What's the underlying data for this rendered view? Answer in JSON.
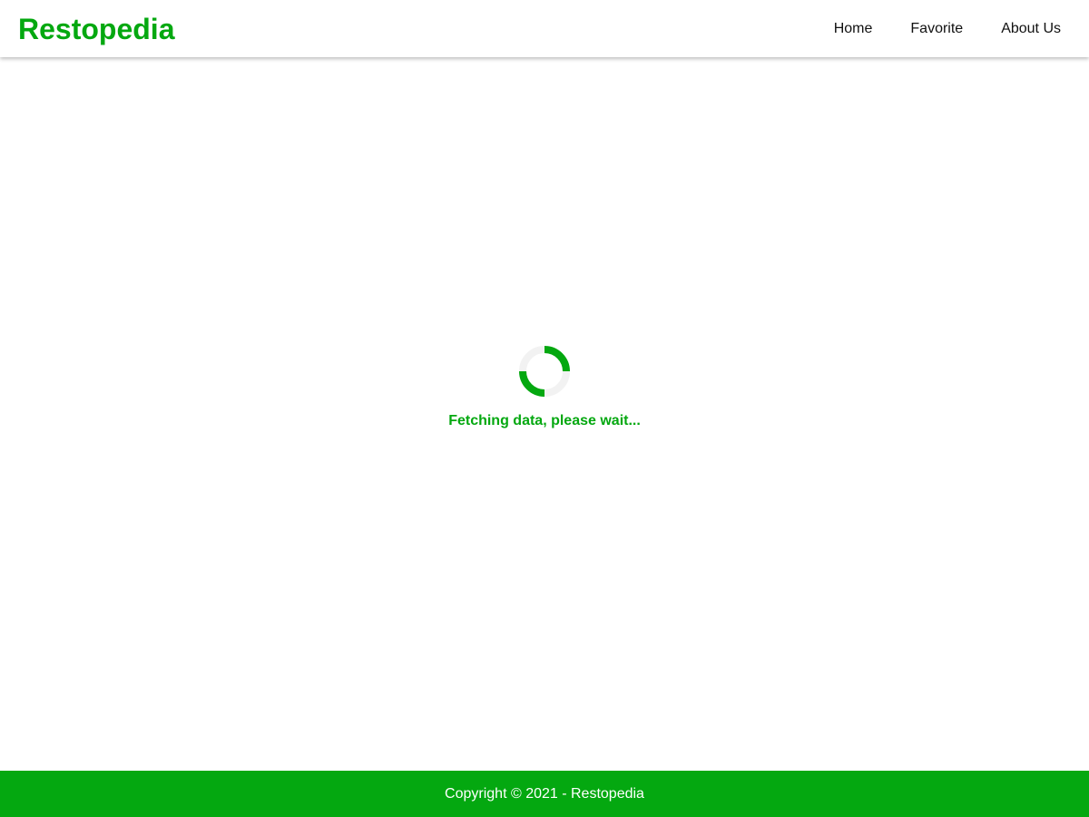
{
  "header": {
    "brand": "Restopedia",
    "nav": [
      {
        "label": "Home"
      },
      {
        "label": "Favorite"
      },
      {
        "label": "About Us"
      }
    ]
  },
  "main": {
    "loading_text": "Fetching data, please wait...",
    "spinner_icon": "loading-spinner-icon"
  },
  "footer": {
    "copyright": "Copyright © 2021 - Restopedia"
  },
  "colors": {
    "brand": "#04a810",
    "footer_bg": "#04a810",
    "spinner_track": "#f2f2f2",
    "text_dark": "#111111",
    "footer_text": "#ffffff"
  }
}
